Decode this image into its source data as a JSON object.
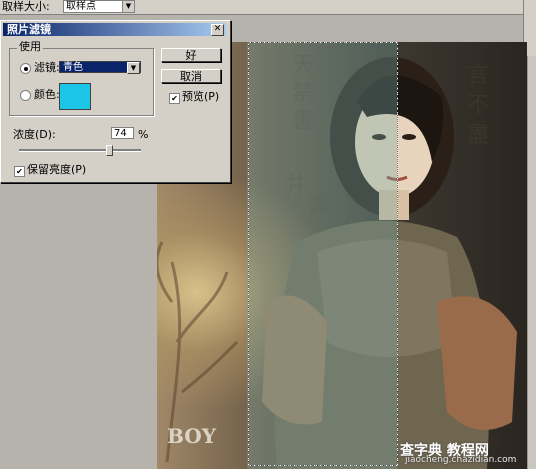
{
  "options_bar": {
    "sample_size_label": "取样大小:",
    "sample_size_value": "取样点"
  },
  "dialog": {
    "title": "照片滤镜",
    "group_label": "使用",
    "filter_label": "滤镜:",
    "filter_value": "青色",
    "color_label": "颜色:",
    "color_swatch": "#1bc6e6",
    "ok_label": "好",
    "cancel_label": "取消",
    "preview_label": "预览(P)",
    "preview_checked": true,
    "density_label": "浓度(D):",
    "density_value": "74",
    "density_unit": "%",
    "preserve_label": "保留亮度(P)",
    "preserve_checked": true
  },
  "photo": {
    "logo_text": "BOY"
  },
  "watermark": {
    "site_name": "查字典 教程网",
    "site_url": "jiaocheng.chazidian.com"
  }
}
